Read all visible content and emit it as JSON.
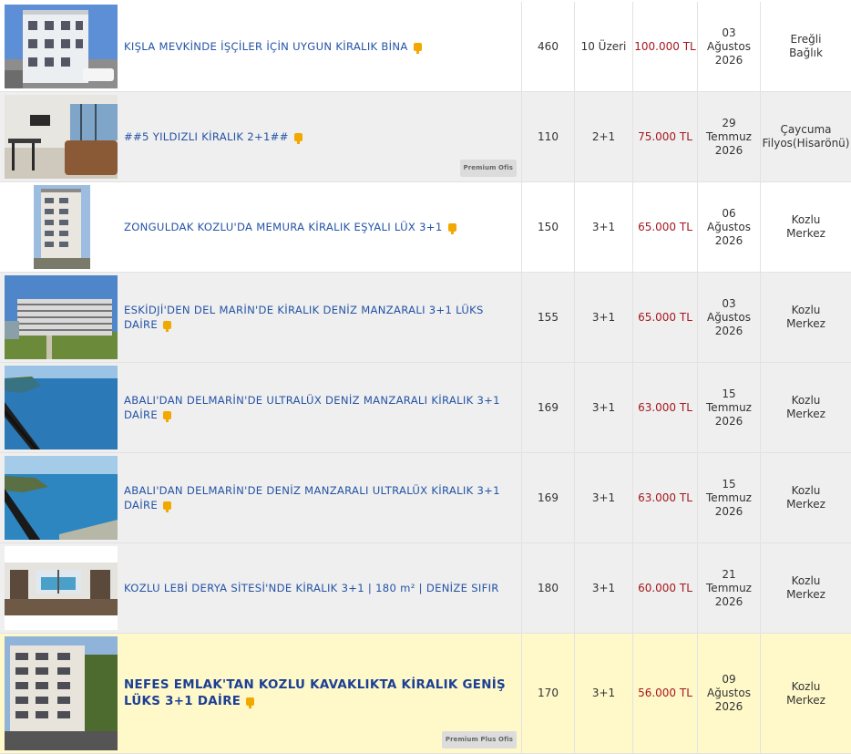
{
  "listings": [
    {
      "title": "KIŞLA MEVKİNDE İŞÇİLER İÇİN UYGUN KİRALIK BİNA",
      "m2": "460",
      "rooms": "10 Üzeri",
      "price": "100.000 TL",
      "date_day": "03",
      "date_month": "Ağustos",
      "date_year": "2026",
      "loc1": "Ereğli",
      "loc2": "Bağlık",
      "badge": ""
    },
    {
      "title": "##5 YILDIZLI KİRALIK 2+1##",
      "m2": "110",
      "rooms": "2+1",
      "price": "75.000 TL",
      "date_day": "29",
      "date_month": "Temmuz",
      "date_year": "2026",
      "loc1": "Çaycuma",
      "loc2": "Filyos(Hisarönü)",
      "badge": "Premium Ofis"
    },
    {
      "title": "ZONGULDAK KOZLU'DA MEMURA KİRALIK EŞYALI LÜX 3+1",
      "m2": "150",
      "rooms": "3+1",
      "price": "65.000 TL",
      "date_day": "06",
      "date_month": "Ağustos",
      "date_year": "2026",
      "loc1": "Kozlu",
      "loc2": "Merkez",
      "badge": ""
    },
    {
      "title": "ESKİDJİ'DEN DEL MARİN'DE KİRALIK DENİZ MANZARALI 3+1 LÜKS DAİRE",
      "m2": "155",
      "rooms": "3+1",
      "price": "65.000 TL",
      "date_day": "03",
      "date_month": "Ağustos",
      "date_year": "2026",
      "loc1": "Kozlu",
      "loc2": "Merkez",
      "badge": ""
    },
    {
      "title": "ABALI'DAN DELMARİN'DE ULTRALÜX DENİZ MANZARALI KİRALIK 3+1 DAİRE",
      "m2": "169",
      "rooms": "3+1",
      "price": "63.000 TL",
      "date_day": "15",
      "date_month": "Temmuz",
      "date_year": "2026",
      "loc1": "Kozlu",
      "loc2": "Merkez",
      "badge": ""
    },
    {
      "title": "ABALI'DAN DELMARİN'DE DENİZ MANZARALI ULTRALÜX KİRALIK 3+1 DAİRE",
      "m2": "169",
      "rooms": "3+1",
      "price": "63.000 TL",
      "date_day": "15",
      "date_month": "Temmuz",
      "date_year": "2026",
      "loc1": "Kozlu",
      "loc2": "Merkez",
      "badge": ""
    },
    {
      "title": "KOZLU LEBİ DERYA SİTESİ'NDE KİRALIK 3+1 | 180 m² | DENİZE SIFIR",
      "m2": "180",
      "rooms": "3+1",
      "price": "60.000 TL",
      "date_day": "21",
      "date_month": "Temmuz",
      "date_year": "2026",
      "loc1": "Kozlu",
      "loc2": "Merkez",
      "badge": ""
    },
    {
      "title": "NEFES EMLAK'TAN KOZLU KAVAKLIKTA KİRALIK GENİŞ LÜKS 3+1 DAİRE",
      "m2": "170",
      "rooms": "3+1",
      "price": "56.000 TL",
      "date_day": "09",
      "date_month": "Ağustos",
      "date_year": "2026",
      "loc1": "Kozlu",
      "loc2": "Merkez",
      "badge": "Premium Plus Ofis"
    }
  ],
  "colors": {
    "link": "#2453a5",
    "price": "#a5181f",
    "highlight_row": "#fff9c9",
    "alt_row": "#efefef",
    "pin": "#f1a800"
  }
}
